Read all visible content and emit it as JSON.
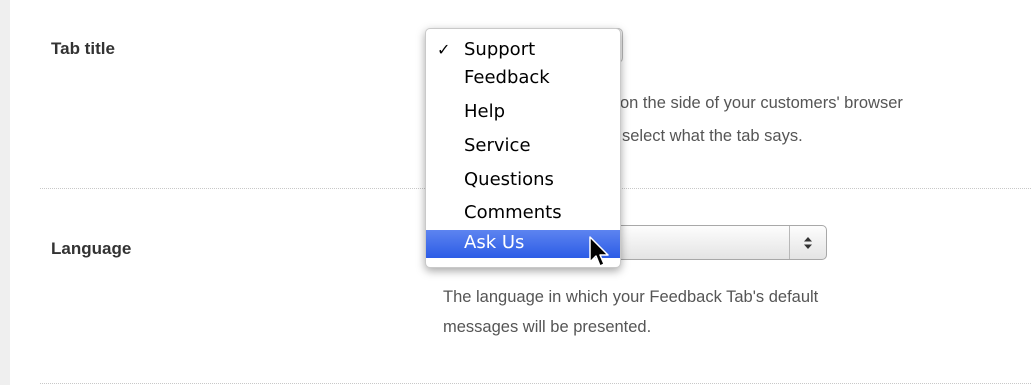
{
  "tab_title": {
    "label": "Tab title",
    "help_line1": "on the side of your customers' browser",
    "help_line2": "select what the tab says.",
    "dropdown": {
      "selected": "Support",
      "highlighted": "Ask Us",
      "options": [
        "Support",
        "Feedback",
        "Help",
        "Service",
        "Questions",
        "Comments",
        "Ask Us"
      ]
    }
  },
  "language": {
    "label": "Language",
    "select_value": "",
    "help_line1": "The language in which your Feedback Tab's default",
    "help_line2": "messages will be presented."
  },
  "icons": {
    "check": "check-icon",
    "select_arrows": "updown-arrows-icon",
    "cursor": "mouse-pointer-icon"
  },
  "colors": {
    "highlight": "#3a6aeb",
    "label": "#333333",
    "help_text": "#555555"
  }
}
